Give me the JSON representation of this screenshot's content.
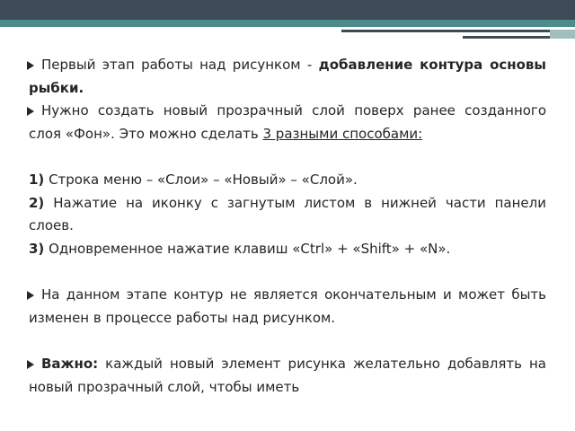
{
  "items": [
    {
      "text": "Первый этап работы над рисунком - ",
      "bold": "добавление контура основы рыбки."
    },
    {
      "text": "Нужно создать новый прозрачный слой поверх ранее созданного слоя «Фон». Это можно сделать ",
      "underline": "3 разными способами:"
    },
    {
      "steps": [
        {
          "num": "1)",
          "text": " Строка меню – «Слои» – «Новый» – «Слой»."
        },
        {
          "num": "2)",
          "text": " Нажатие на иконку с загнутым листом в нижней части панели слоев."
        },
        {
          "num": "3)",
          "text": " Одновременное нажатие клавиш «Ctrl» + «Shift» + «N»."
        }
      ]
    },
    {
      "text": "На данном этапе контур не является окончательным и может быть изменен в процессе работы над рисунком."
    },
    {
      "bold": "Важно:",
      "text": " каждый новый элемент рисунка желательно добавлять на новый прозрачный слой, чтобы иметь"
    }
  ]
}
